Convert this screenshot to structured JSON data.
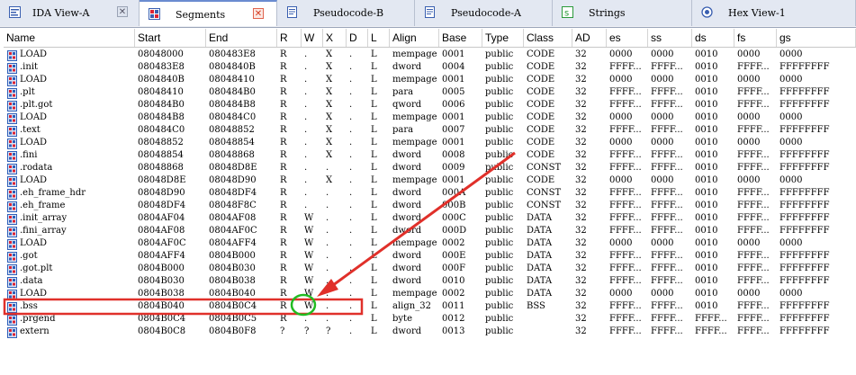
{
  "tabs": [
    {
      "label": "IDA View-A",
      "icon": "disassembly-icon",
      "active": false
    },
    {
      "label": "Segments",
      "icon": "segments-icon",
      "active": true
    },
    {
      "label": "Pseudocode-B",
      "icon": "pseudocode-icon",
      "active": false
    },
    {
      "label": "Pseudocode-A",
      "icon": "pseudocode-icon",
      "active": false
    },
    {
      "label": "Strings",
      "icon": "strings-icon",
      "active": false
    },
    {
      "label": "Hex View-1",
      "icon": "hex-view-icon",
      "active": false
    }
  ],
  "close_glyph": "✕",
  "columns": [
    "Name",
    "Start",
    "End",
    "R",
    "W",
    "X",
    "D",
    "L",
    "Align",
    "Base",
    "Type",
    "Class",
    "AD",
    "es",
    "ss",
    "ds",
    "fs",
    "gs"
  ],
  "rows": [
    [
      "LOAD",
      "08048000",
      "080483E8",
      "R",
      ".",
      "X",
      ".",
      "L",
      "mempage",
      "0001",
      "public",
      "CODE",
      "32",
      "0000",
      "0000",
      "0010",
      "0000",
      "0000"
    ],
    [
      ".init",
      "080483E8",
      "0804840B",
      "R",
      ".",
      "X",
      ".",
      "L",
      "dword",
      "0004",
      "public",
      "CODE",
      "32",
      "FFFF...",
      "FFFF...",
      "0010",
      "FFFF...",
      "FFFFFFFF"
    ],
    [
      "LOAD",
      "0804840B",
      "08048410",
      "R",
      ".",
      "X",
      ".",
      "L",
      "mempage",
      "0001",
      "public",
      "CODE",
      "32",
      "0000",
      "0000",
      "0010",
      "0000",
      "0000"
    ],
    [
      ".plt",
      "08048410",
      "080484B0",
      "R",
      ".",
      "X",
      ".",
      "L",
      "para",
      "0005",
      "public",
      "CODE",
      "32",
      "FFFF...",
      "FFFF...",
      "0010",
      "FFFF...",
      "FFFFFFFF"
    ],
    [
      ".plt.got",
      "080484B0",
      "080484B8",
      "R",
      ".",
      "X",
      ".",
      "L",
      "qword",
      "0006",
      "public",
      "CODE",
      "32",
      "FFFF...",
      "FFFF...",
      "0010",
      "FFFF...",
      "FFFFFFFF"
    ],
    [
      "LOAD",
      "080484B8",
      "080484C0",
      "R",
      ".",
      "X",
      ".",
      "L",
      "mempage",
      "0001",
      "public",
      "CODE",
      "32",
      "0000",
      "0000",
      "0010",
      "0000",
      "0000"
    ],
    [
      ".text",
      "080484C0",
      "08048852",
      "R",
      ".",
      "X",
      ".",
      "L",
      "para",
      "0007",
      "public",
      "CODE",
      "32",
      "FFFF...",
      "FFFF...",
      "0010",
      "FFFF...",
      "FFFFFFFF"
    ],
    [
      "LOAD",
      "08048852",
      "08048854",
      "R",
      ".",
      "X",
      ".",
      "L",
      "mempage",
      "0001",
      "public",
      "CODE",
      "32",
      "0000",
      "0000",
      "0010",
      "0000",
      "0000"
    ],
    [
      ".fini",
      "08048854",
      "08048868",
      "R",
      ".",
      "X",
      ".",
      "L",
      "dword",
      "0008",
      "public",
      "CODE",
      "32",
      "FFFF...",
      "FFFF...",
      "0010",
      "FFFF...",
      "FFFFFFFF"
    ],
    [
      ".rodata",
      "08048868",
      "08048D8E",
      "R",
      ".",
      ".",
      ".",
      "L",
      "dword",
      "0009",
      "public",
      "CONST",
      "32",
      "FFFF...",
      "FFFF...",
      "0010",
      "FFFF...",
      "FFFFFFFF"
    ],
    [
      "LOAD",
      "08048D8E",
      "08048D90",
      "R",
      ".",
      "X",
      ".",
      "L",
      "mempage",
      "0001",
      "public",
      "CODE",
      "32",
      "0000",
      "0000",
      "0010",
      "0000",
      "0000"
    ],
    [
      ".eh_frame_hdr",
      "08048D90",
      "08048DF4",
      "R",
      ".",
      ".",
      ".",
      "L",
      "dword",
      "000A",
      "public",
      "CONST",
      "32",
      "FFFF...",
      "FFFF...",
      "0010",
      "FFFF...",
      "FFFFFFFF"
    ],
    [
      ".eh_frame",
      "08048DF4",
      "08048F8C",
      "R",
      ".",
      ".",
      ".",
      "L",
      "dword",
      "000B",
      "public",
      "CONST",
      "32",
      "FFFF...",
      "FFFF...",
      "0010",
      "FFFF...",
      "FFFFFFFF"
    ],
    [
      ".init_array",
      "0804AF04",
      "0804AF08",
      "R",
      "W",
      ".",
      ".",
      "L",
      "dword",
      "000C",
      "public",
      "DATA",
      "32",
      "FFFF...",
      "FFFF...",
      "0010",
      "FFFF...",
      "FFFFFFFF"
    ],
    [
      ".fini_array",
      "0804AF08",
      "0804AF0C",
      "R",
      "W",
      ".",
      ".",
      "L",
      "dword",
      "000D",
      "public",
      "DATA",
      "32",
      "FFFF...",
      "FFFF...",
      "0010",
      "FFFF...",
      "FFFFFFFF"
    ],
    [
      "LOAD",
      "0804AF0C",
      "0804AFF4",
      "R",
      "W",
      ".",
      ".",
      "L",
      "mempage",
      "0002",
      "public",
      "DATA",
      "32",
      "0000",
      "0000",
      "0010",
      "0000",
      "0000"
    ],
    [
      ".got",
      "0804AFF4",
      "0804B000",
      "R",
      "W",
      ".",
      ".",
      "L",
      "dword",
      "000E",
      "public",
      "DATA",
      "32",
      "FFFF...",
      "FFFF...",
      "0010",
      "FFFF...",
      "FFFFFFFF"
    ],
    [
      ".got.plt",
      "0804B000",
      "0804B030",
      "R",
      "W",
      ".",
      ".",
      "L",
      "dword",
      "000F",
      "public",
      "DATA",
      "32",
      "FFFF...",
      "FFFF...",
      "0010",
      "FFFF...",
      "FFFFFFFF"
    ],
    [
      ".data",
      "0804B030",
      "0804B038",
      "R",
      "W",
      ".",
      ".",
      "L",
      "dword",
      "0010",
      "public",
      "DATA",
      "32",
      "FFFF...",
      "FFFF...",
      "0010",
      "FFFF...",
      "FFFFFFFF"
    ],
    [
      "LOAD",
      "0804B038",
      "0804B040",
      "R",
      "W",
      ".",
      ".",
      "L",
      "mempage",
      "0002",
      "public",
      "DATA",
      "32",
      "0000",
      "0000",
      "0010",
      "0000",
      "0000"
    ],
    [
      ".bss",
      "0804B040",
      "0804B0C4",
      "R",
      "W",
      ".",
      ".",
      "L",
      "align_32",
      "0011",
      "public",
      "BSS",
      "32",
      "FFFF...",
      "FFFF...",
      "0010",
      "FFFF...",
      "FFFFFFFF"
    ],
    [
      ".prgend",
      "0804B0C4",
      "0804B0C5",
      "R",
      ".",
      ".",
      ".",
      "L",
      "byte",
      "0012",
      "public",
      "",
      "32",
      "FFFF...",
      "FFFF...",
      "FFFF...",
      "FFFF...",
      "FFFFFFFF"
    ],
    [
      "extern",
      "0804B0C8",
      "0804B0F8",
      "?",
      "?",
      "?",
      ".",
      "L",
      "dword",
      "0013",
      "public",
      "",
      "32",
      "FFFF...",
      "FFFF...",
      "FFFF...",
      "FFFF...",
      "FFFFFFFF"
    ]
  ],
  "highlight_row": ".bss",
  "colors": {
    "annotation_red": "#e0302a",
    "annotation_green": "#22bb22",
    "row_icon_blue": "#2f5fb8"
  }
}
